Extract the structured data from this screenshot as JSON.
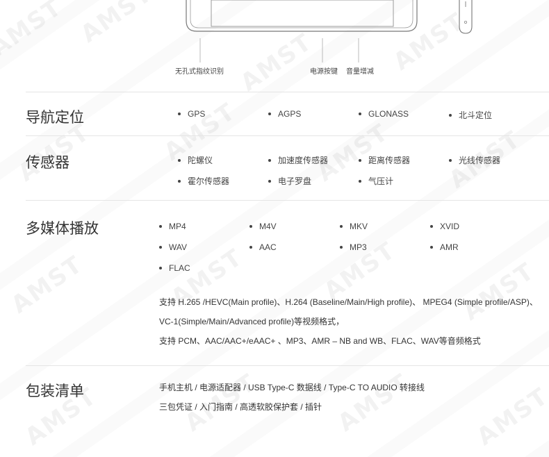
{
  "top": {
    "labels": {
      "fingerprint": "无孔式指纹识别",
      "power": "电源按键",
      "volume": "音量增减"
    }
  },
  "navigation": {
    "title": "导航定位",
    "items": [
      "GPS",
      "AGPS",
      "GLONASS",
      "北斗定位"
    ]
  },
  "sensors": {
    "title": "传感器",
    "items": [
      "陀螺仪",
      "加速度传感器",
      "距离传感器",
      "光线传感器",
      "霍尔传感器",
      "电子罗盘",
      "气压计"
    ]
  },
  "multimedia": {
    "title": "多媒体播放",
    "items": [
      "MP4",
      "M4V",
      "MKV",
      "XVID",
      "WAV",
      "AAC",
      "MP3",
      "AMR",
      "FLAC"
    ],
    "paragraph": [
      "支持 H.265 /HEVC(Main profile)、H.264 (Baseline/Main/High profile)、 MPEG4 (Simple profile/ASP)、",
      "VC-1(Simple/Main/Advanced profile)等视频格式，",
      "支持 PCM、AAC/AAC+/eAAC+ 、MP3、AMR – NB and WB、FLAC、WAV等音频格式"
    ]
  },
  "package": {
    "title": "包装清单",
    "lines": [
      "手机主机 / 电源适配器 / USB Type-C 数据线 / Type-C TO AUDIO 转接线",
      "三包凭证 / 入门指南 / 高透软胶保护套 / 插针"
    ]
  }
}
